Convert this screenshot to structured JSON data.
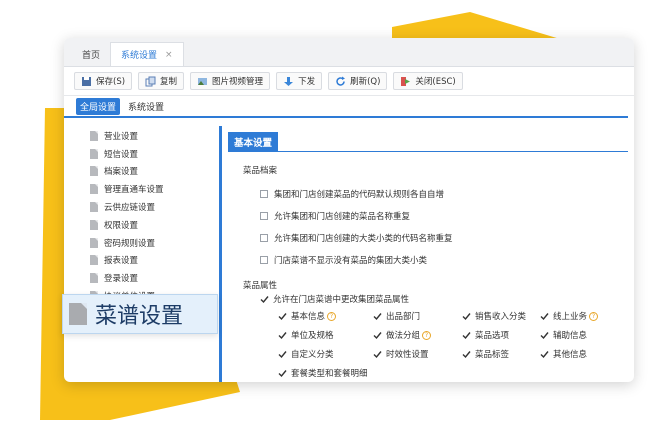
{
  "colors": {
    "accent": "#2e7bd6",
    "deco_yellow": "#f7c019",
    "help_orange": "#e8a72b"
  },
  "tabs": [
    {
      "label": "首页"
    },
    {
      "label": "系统设置",
      "close": "×"
    }
  ],
  "toolbar": {
    "save": "保存(S)",
    "copy": "复制",
    "media": "图片视频管理",
    "download": "下发",
    "refresh": "刷新(Q)",
    "close": "关闭(ESC)"
  },
  "subtabs": [
    {
      "label": "全局设置"
    },
    {
      "label": "系统设置"
    }
  ],
  "sidebar": {
    "items": [
      {
        "label": "营业设置"
      },
      {
        "label": "短信设置"
      },
      {
        "label": "档案设置"
      },
      {
        "label": "管理直通车设置"
      },
      {
        "label": "云供应链设置"
      },
      {
        "label": "权限设置"
      },
      {
        "label": "密码规则设置"
      },
      {
        "label": "报表设置"
      },
      {
        "label": "登录设置"
      },
      {
        "label": "协议单位设置"
      }
    ],
    "highlight": "菜谱设置"
  },
  "panel": {
    "title": "基本设置",
    "archive": {
      "label": "菜品档案",
      "options": [
        "集团和门店创建菜品的代码默认规则各自自增",
        "允许集团和门店创建的菜品名称重复",
        "允许集团和门店创建的大类小类的代码名称重复",
        "门店菜谱不显示没有菜品的集团大类小类"
      ]
    },
    "attrs": {
      "label": "菜品属性",
      "master": "允许在门店菜谱中更改集团菜品属性",
      "items": [
        "基本信息",
        "出品部门",
        "销售收入分类",
        "线上业务",
        "单位及规格",
        "做法分组",
        "菜品选项",
        "辅助信息",
        "自定义分类",
        "时效性设置",
        "菜品标签",
        "其他信息",
        "套餐类型和套餐明细"
      ],
      "help_mark": "?"
    }
  }
}
